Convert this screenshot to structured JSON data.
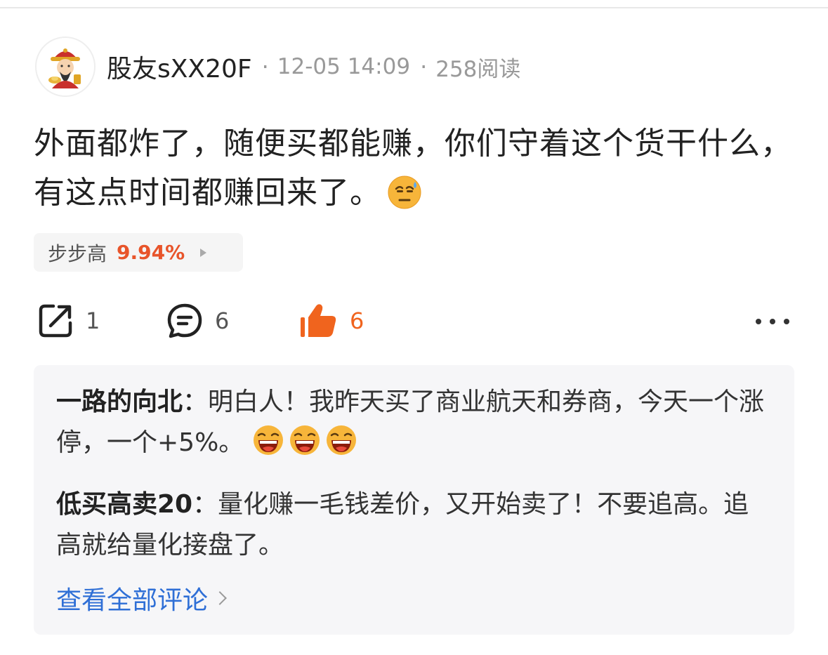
{
  "post": {
    "author": "股友sXX20F",
    "separator": "·",
    "time": "12-05 14:09",
    "reads": "258阅读",
    "text": "外面都炸了，随便买都能赚，你们守着这个货干什么，有这点时间都赚回来了。",
    "text_emoji": "sweat-smile-emoji"
  },
  "stock_tag": {
    "name": "步步高",
    "change": "9.94%",
    "change_color": "#e8542a"
  },
  "actions": {
    "share_count": "1",
    "comment_count": "6",
    "like_count": "6",
    "like_color": "#f0641e"
  },
  "comments": [
    {
      "author": "一路的向北",
      "separator": "：",
      "text": "明白人！我昨天买了商业航天和券商，今天一个涨停，一个+5%。",
      "emojis": [
        "laughing-emoji",
        "laughing-emoji",
        "laughing-emoji"
      ]
    },
    {
      "author": "低买高卖20",
      "separator": "：",
      "text": "量化赚一毛钱差价，又开始卖了！不要追高。追高就给量化接盘了。"
    }
  ],
  "view_all_label": "查看全部评论",
  "link_color": "#2f6fd6"
}
